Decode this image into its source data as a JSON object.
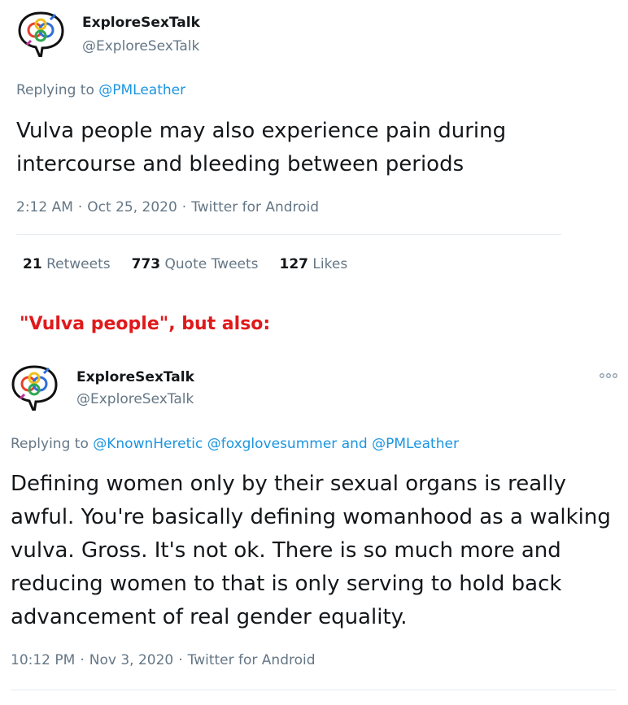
{
  "tweet1": {
    "display_name": "ExploreSexTalk",
    "handle": "@ExploreSexTalk",
    "replying_prefix": "Replying to",
    "replying_to": [
      "@PMLeather"
    ],
    "text": "Vulva people may also experience pain during intercourse and bleeding between periods",
    "time": "2:12 AM",
    "date": "Oct 25, 2020",
    "source": "Twitter for Android",
    "separator": "·",
    "stats": {
      "retweets_count": "21",
      "retweets_label": "Retweets",
      "quotes_count": "773",
      "quotes_label": "Quote Tweets",
      "likes_count": "127",
      "likes_label": "Likes"
    }
  },
  "caption": "\"Vulva people\", but also:",
  "tweet2": {
    "display_name": "ExploreSexTalk",
    "handle": "@ExploreSexTalk",
    "more_icon": "ellipsis-icon",
    "replying_prefix": "Replying to",
    "replying_to_1": "@KnownHeretic",
    "replying_to_2": "@foxglovesummer",
    "replying_and": "and",
    "replying_to_3": "@PMLeather",
    "text": "Defining women only by their sexual organs is really awful. You're basically defining womanhood as a walking vulva. Gross. It's not ok. There is so much more and reducing women to that is only serving to hold back advancement of real gender equality.",
    "time": "10:12 PM",
    "date": "Nov 3, 2020",
    "source": "Twitter for Android",
    "separator": "·"
  },
  "colors": {
    "link": "#1b95e0",
    "caption": "#e0191b",
    "muted": "#657786"
  }
}
